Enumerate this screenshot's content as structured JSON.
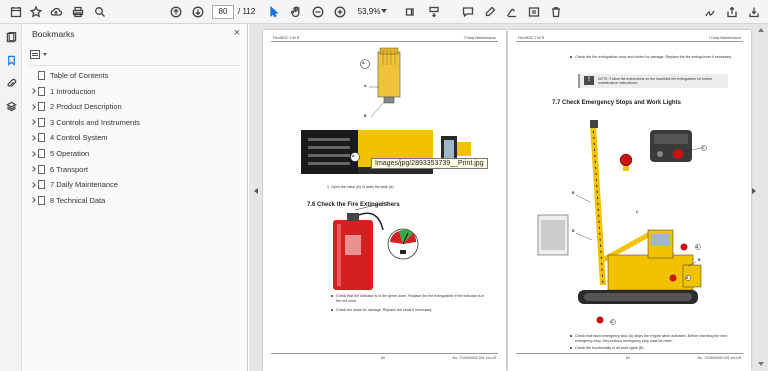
{
  "toolbar": {
    "page_current": "80",
    "page_total": "/ 112",
    "zoom": "53,9%"
  },
  "bookmarks": {
    "title": "Bookmarks",
    "close": "×",
    "items": [
      {
        "label": "Table of Contents",
        "expandable": false
      },
      {
        "label": "1 Introduction",
        "expandable": true
      },
      {
        "label": "2 Product Description",
        "expandable": true
      },
      {
        "label": "3 Controls and Instruments",
        "expandable": true
      },
      {
        "label": "4 Control System",
        "expandable": true
      },
      {
        "label": "5 Operation",
        "expandable": true
      },
      {
        "label": "6 Transport",
        "expandable": true
      },
      {
        "label": "7 Daily Maintenance",
        "expandable": true
      },
      {
        "label": "8 Technical Data",
        "expandable": true
      }
    ]
  },
  "tooltip": "Images/jpg/2893353739__Print.jpg",
  "left_page": {
    "header_left": "FlexiROC T40 R",
    "header_right": "7 Daily Maintenance",
    "step_text": "1.  Open the valve (B) to drain the tank (A).",
    "section_title": "7.6  Check the Fire Extinguishers",
    "bullet1": "Check that the indicator is in the green zone. Replace the fire extinguisher if the indicator is in the red zone.",
    "bullet2": "Check the seals for damage. Replace the seals if necessary.",
    "footer_page": "80",
    "footer_doc": "No. 7G3009432.001 en-US",
    "label_a": "A",
    "label_b": "B"
  },
  "right_page": {
    "header_left": "FlexiROC T40 R",
    "header_right": "7 Daily Maintenance",
    "bullet_top": "Check the fire extinguisher body and holder for damage. Replace the fire extinguisher if necessary.",
    "note_text": "NOTE: Follow the instructions on the handheld fire extinguisher for further maintenance instructions.",
    "section_title": "7.7  Check Emergency Stops and Work Lights",
    "bullet1": "Check that each emergency stop (A) stops the engine when activated. Before checking the next emergency stop, the previous emergency stop must be reset.",
    "bullet2": "Check the functionality of all work lights (B).",
    "footer_page": "81",
    "footer_doc": "No. 7G3009432.001 en-US",
    "label_a": "A",
    "label_b": "B",
    "label_c": "C"
  },
  "colors": {
    "accent": "#1473e6",
    "machine_yellow": "#f2c200",
    "extinguisher_red": "#d32020",
    "estop_red": "#cc1111"
  }
}
